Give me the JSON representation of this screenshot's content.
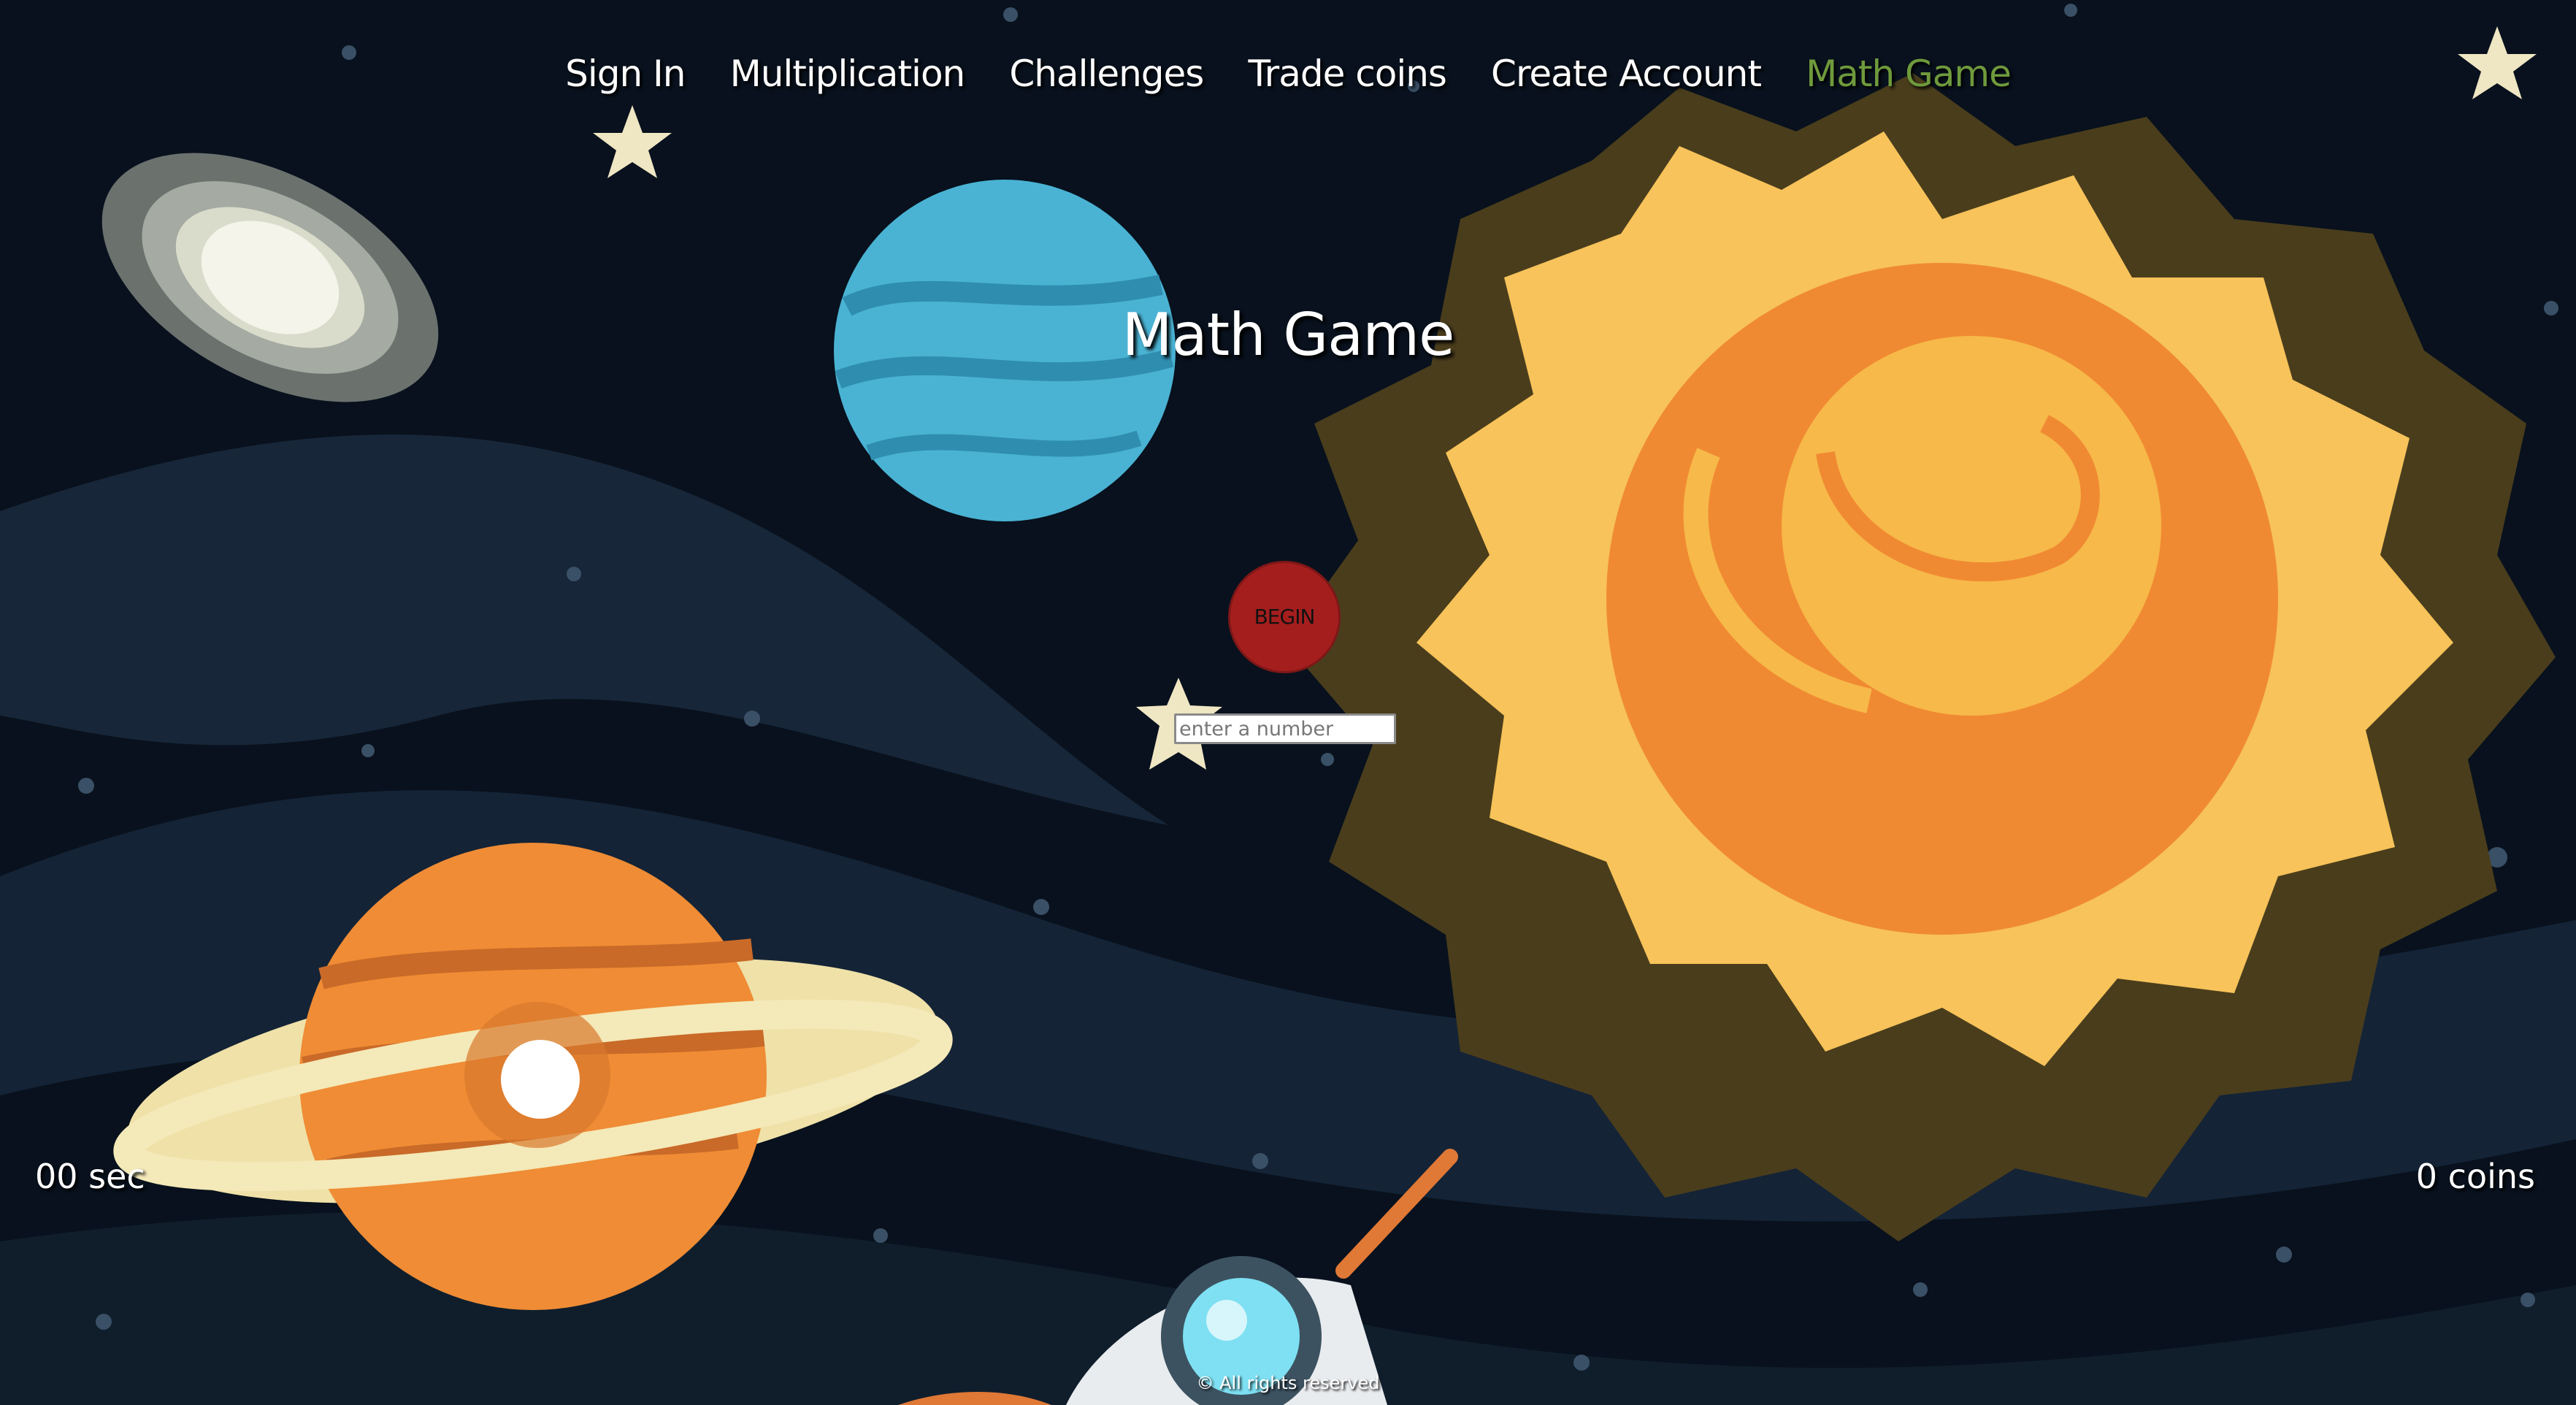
{
  "nav": {
    "items": [
      {
        "label": "Sign In"
      },
      {
        "label": "Multiplication"
      },
      {
        "label": "Challenges"
      },
      {
        "label": "Trade coins"
      },
      {
        "label": "Create Account"
      },
      {
        "label": "Math Game"
      }
    ],
    "active_color": "#6f9a3c"
  },
  "page": {
    "title": "Math Game"
  },
  "game": {
    "begin_label": "BEGIN",
    "input_placeholder": "enter a number",
    "input_value": "",
    "timer": "00 sec",
    "coins": "0 coins"
  },
  "footer": {
    "text": "© All rights reserved"
  },
  "colors": {
    "background": "#08111d",
    "begin_button": "#a51e1e",
    "sun_outer": "#f7c35a",
    "sun_inner": "#f08a32",
    "planet_blue": "#4ab3d4",
    "planet_orange": "#ef8c35"
  }
}
